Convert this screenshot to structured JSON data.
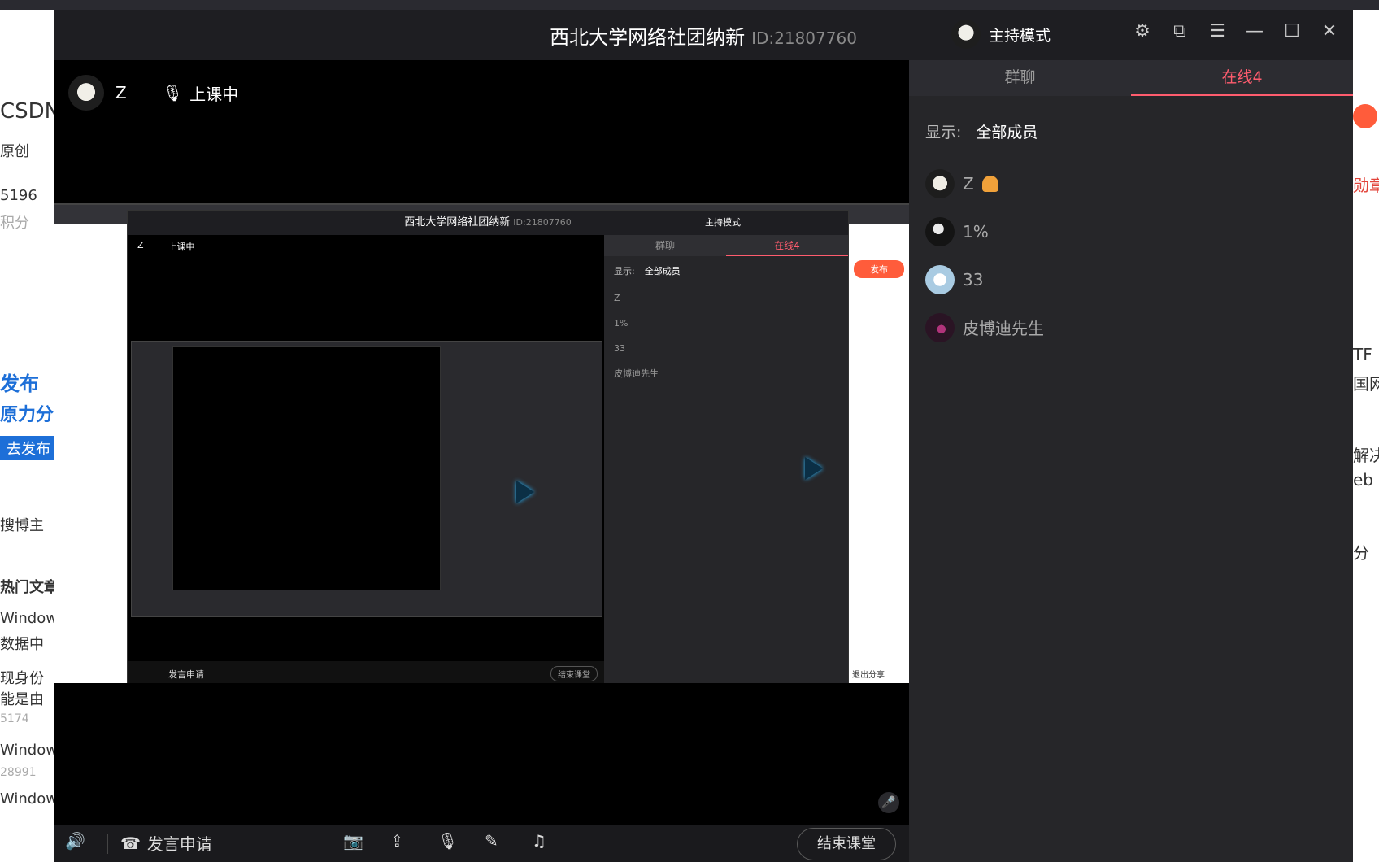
{
  "background": {
    "left_lines": [
      "CSDN",
      "原创",
      "5196",
      "积分",
      "发布",
      "原力分",
      "去发布",
      "搜博主",
      "热门文章",
      "Windows",
      "数据中",
      "现身份",
      "能是由",
      "5174",
      "Windows",
      "28991",
      "Windows"
    ],
    "right_lines": [
      "勋章",
      "TF",
      "国网",
      "解决",
      "eb",
      "分"
    ]
  },
  "titlebar": {
    "title": "西北大学网络社团纳新",
    "id": "ID:21807760",
    "host_mode_label": "主持模式",
    "icons": [
      "settings-icon",
      "popout-icon",
      "menu-icon",
      "minimize-icon",
      "maximize-icon",
      "close-icon"
    ]
  },
  "stage": {
    "presenter_name": "Z",
    "status_label": "上课中"
  },
  "shared_screen": {
    "title": "西北大学网络社团纳新",
    "id": "ID:21807760",
    "host_mode_label": "主持模式",
    "presenter_name": "Z",
    "status_label": "上课中",
    "tabs": [
      "群聊",
      "在线4"
    ],
    "filter_label": "显示:",
    "filter_value": "全部成员",
    "members": [
      "Z",
      "1%",
      "33",
      "皮博迪先生"
    ],
    "apply_label": "发言申请",
    "end_label": "结束课堂",
    "publish_label": "发布",
    "exit_share_label": "退出分享"
  },
  "toolbar": {
    "speaker_icon": "speaker-icon",
    "apply_label": "发言申请",
    "end_label": "结束课堂"
  },
  "sidebar": {
    "tabs": [
      {
        "label": "群聊",
        "active": false
      },
      {
        "label": "在线4",
        "active": true
      }
    ],
    "filter_label": "显示:",
    "filter_value": "全部成员",
    "members": [
      {
        "name": "Z",
        "is_host": true,
        "avatar_color": "#e8e6df"
      },
      {
        "name": "1%",
        "is_host": false,
        "avatar_color": "#1a1a1a"
      },
      {
        "name": "33",
        "is_host": false,
        "avatar_color": "#cfe6f7"
      },
      {
        "name": "皮博迪先生",
        "is_host": false,
        "avatar_color": "#3a1e33"
      }
    ]
  },
  "colors": {
    "accent": "#ff5c6e",
    "panel": "#262629",
    "host_badge": "#f0a13a"
  }
}
